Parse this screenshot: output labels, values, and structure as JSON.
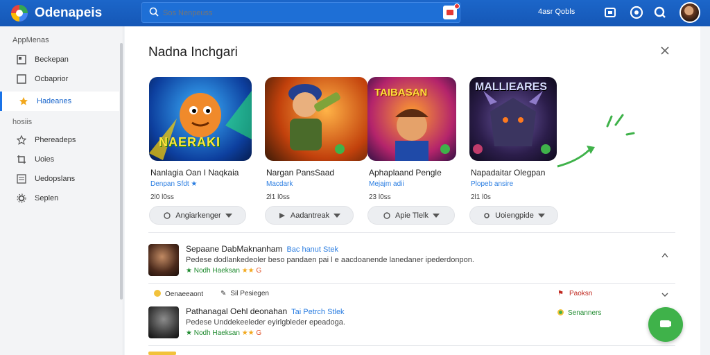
{
  "header": {
    "title": "Odenapeis",
    "search_placeholder": "Sos Nenpeuss",
    "user_name": "4asr Qobls",
    "icons": [
      "grid-icon",
      "settings-circle-icon",
      "search-icon",
      "cart-icon"
    ]
  },
  "sidebar": {
    "section_title": "AppMenas",
    "items": [
      {
        "label": "Beckepan",
        "icon": "grid-icon"
      },
      {
        "label": "Ocbaprior",
        "icon": "square-icon"
      },
      {
        "label": "Hadeanes",
        "icon": "star-icon",
        "active": true
      }
    ],
    "section2_title": "hosiis",
    "items2": [
      {
        "label": "Phereadeps",
        "icon": "star-outline-icon"
      },
      {
        "label": "Uoies",
        "icon": "crop-icon"
      },
      {
        "label": "Uedopslans",
        "icon": "list-icon"
      },
      {
        "label": "Seplen",
        "icon": "gear-icon"
      }
    ]
  },
  "panel": {
    "title": "Nadna Inchgari",
    "cards": [
      {
        "name": "Nanlagia Oan I Naqkaia",
        "sub": "Denpan Sfdt ★",
        "meta": "2l0 l0ss",
        "button": "Angiarkenger",
        "thumb_text": "NAERAKI"
      },
      {
        "name": "Nargan PansSaad",
        "sub": "Macdark",
        "meta": "2l1 l0ss",
        "button": "Aadantreak",
        "thumb_text": ""
      },
      {
        "name": "Aphaplaand Pengle",
        "sub": "Mejajm adii",
        "meta": "23 l0ss",
        "button": "Apie Tlelk",
        "thumb_text": "TAIBASAN"
      },
      {
        "name": "Napadaitar Olegpan",
        "sub": "Plopeb ansire",
        "meta": "2l1 l0s",
        "button": "Uoiengpide",
        "thumb_text": "MALLIEARES"
      }
    ],
    "list": [
      {
        "title": "Sepaane DabMaknanham",
        "link": "Bac hanut Stek",
        "desc": "Pedese dodlankedeoler beso pandaen pai l e aacdoanende lanedaner ipederdonpon.",
        "tag": "Nodh Haeksan",
        "stars": "★★",
        "extra": "G"
      },
      {
        "title": "Pathanagal Oehl deonahan",
        "link": "Tai Petrch Stlek",
        "desc": "Pedese Unddekeeleder eyirlgbleder epeadoga.",
        "tag": "Nodh Haeksan",
        "stars": "★★",
        "extra": "G"
      }
    ],
    "actions": {
      "left": "Oenaeeaont",
      "mid": "Sil Pesiegen",
      "right": "Paoksn"
    },
    "status": "Senanners"
  },
  "colors": {
    "topbar": "#1557b6",
    "accent": "#1a73e8",
    "fab": "#3fb24a",
    "link": "#2a7de1",
    "success": "#1e8a2e"
  }
}
